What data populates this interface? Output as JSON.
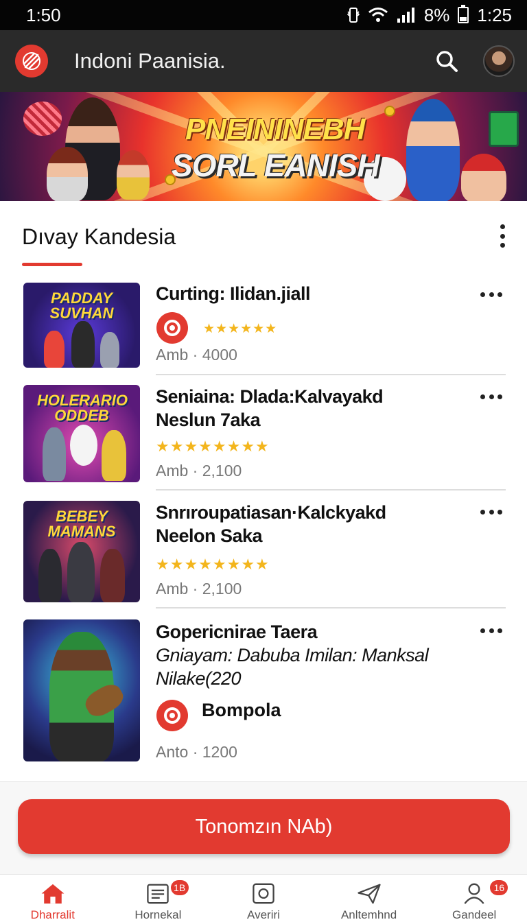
{
  "status_bar": {
    "left_time": "1:50",
    "battery": "8%",
    "right_time": "1:25"
  },
  "app_bar": {
    "title": "Indoni Paanisia."
  },
  "banner": {
    "line1": "PNEININEBH",
    "line2": "SORL EANISH"
  },
  "section": {
    "title": "Dıvay Kandesia"
  },
  "items": [
    {
      "thumb_label": "PADDAY SUVHAN",
      "title": "Curting: Ilidan.jiall",
      "rating_stars": "★★★★★★",
      "meta": "Amb · 4000"
    },
    {
      "thumb_label": "HOLERARIO ODDEB",
      "title_line1": "Seniaina: Dlada:Kalvayakd",
      "title_line2": "Neslun 7aka",
      "rating_stars": "★★★★★★★★",
      "meta": "Amb · 2,100"
    },
    {
      "thumb_label": "BEBEY MAMANS",
      "title_line1": "Snrıroupatiasan·Kalckyakd",
      "title_line2": "Neelon Saka",
      "rating_stars": "★★★★★★★★",
      "meta": "Amb · 2,100"
    },
    {
      "title": "Gopericnirae Taera",
      "sub_line1": "Gniayam: Dabuba Imilan: Manksal",
      "sub_line2": "Nilake(220",
      "brand": "Bompola",
      "meta": "Anto · 1200"
    }
  ],
  "cta": {
    "label": "Tonomzın NAb)"
  },
  "bottom_nav": [
    {
      "label": "Dharralit",
      "icon": "home-icon",
      "active": true
    },
    {
      "label": "Hornekal",
      "icon": "list-icon",
      "badge": "1B"
    },
    {
      "label": "Averiri",
      "icon": "square-icon"
    },
    {
      "label": "Anltemhnd",
      "icon": "send-icon"
    },
    {
      "label": "Gandeel",
      "icon": "person-icon",
      "badge": "16"
    }
  ],
  "colors": {
    "accent": "#e23a30",
    "app_bar": "#2a2a2a",
    "star": "#f3b51c"
  }
}
